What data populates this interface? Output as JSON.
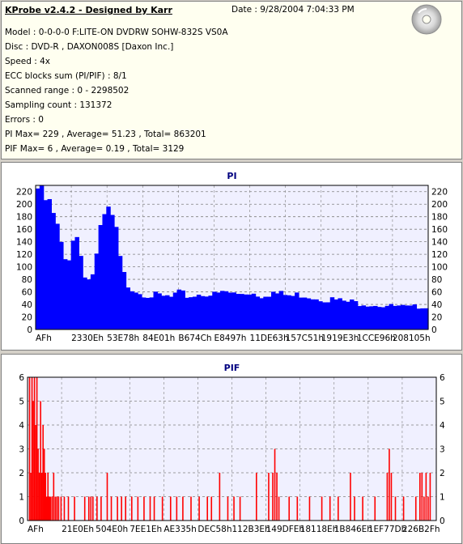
{
  "info": {
    "app_title": "KProbe v2.4.2 - Designed by Karr",
    "date": "Date : 9/28/2004 7:04:33 PM",
    "lines": [
      "Model : 0-0-0-0 F:LITE-ON DVDRW SOHW-832S  VS0A",
      "Disc : DVD-R , DAXON008S [Daxon Inc.]",
      "Speed : 4x",
      "ECC blocks sum (PI/PIF) : 8/1",
      "Scanned range : 0 - 2298502",
      "Sampling count : 131372",
      "Errors : 0",
      "PI Max= 229 , Average= 51.23 , Total= 863201",
      "PIF Max= 6 , Average= 0.19 , Total= 3129"
    ],
    "icon": "cd-disc-icon"
  },
  "colors": {
    "pi_bar": "#0000ff",
    "pif_bar": "#ff0000",
    "plot_bg": "#f0f0ff",
    "grid": "#808080",
    "title": "#000080"
  },
  "chart_data": [
    {
      "type": "area",
      "title": "PI",
      "ylim": [
        0,
        230
      ],
      "yticks": [
        0,
        20,
        40,
        60,
        80,
        100,
        120,
        140,
        160,
        180,
        200,
        220
      ],
      "xticks": [
        "AFh",
        "2330Eh",
        "53E78h",
        "84E01h",
        "B674Ch",
        "E8497h",
        "11DE63h",
        "157C51h",
        "1919E3h",
        "1CCE96h",
        "208105h"
      ],
      "x_range": [
        0,
        2298502
      ],
      "grid": true,
      "series": [
        {
          "values": [
            225,
            212,
            205,
            195,
            178,
            160,
            130,
            110,
            120,
            150,
            148,
            120,
            92,
            80,
            90,
            115,
            150,
            175,
            182,
            176,
            150,
            110,
            85,
            72,
            68,
            64,
            60,
            58,
            56,
            55,
            54,
            53,
            52,
            52,
            51,
            55,
            57,
            56,
            54,
            53,
            55,
            56,
            57,
            58,
            56,
            55,
            57,
            58,
            60,
            58,
            57,
            56,
            58,
            59,
            60,
            58,
            56,
            55,
            57,
            58,
            59,
            57,
            56,
            55,
            54,
            53,
            55,
            56,
            55,
            54,
            52,
            51,
            50,
            49,
            48,
            48,
            47,
            46,
            45,
            44,
            44,
            43,
            42,
            42,
            41,
            40,
            40,
            39,
            38,
            38,
            37,
            37,
            36,
            36,
            35,
            35,
            36,
            37,
            38,
            36
          ]
        }
      ]
    },
    {
      "type": "bar",
      "title": "PIF",
      "ylim": [
        0,
        6
      ],
      "yticks": [
        0,
        1,
        2,
        3,
        4,
        5,
        6
      ],
      "xticks": [
        "AFh",
        "21E0Eh",
        "504E0h",
        "7EE1Eh",
        "AE335h",
        "DEC58h",
        "112B3Eh",
        "149DFEh",
        "18118Eh",
        "1B846Eh",
        "1EF77Dh",
        "226B2Fh"
      ],
      "x_range": [
        0,
        2298502
      ],
      "grid": true,
      "series": [
        {
          "points": [
            [
              0.005,
              6
            ],
            [
              0.008,
              2
            ],
            [
              0.011,
              6
            ],
            [
              0.014,
              5
            ],
            [
              0.017,
              6
            ],
            [
              0.02,
              4
            ],
            [
              0.023,
              6
            ],
            [
              0.026,
              3
            ],
            [
              0.029,
              2
            ],
            [
              0.032,
              5
            ],
            [
              0.035,
              2
            ],
            [
              0.038,
              4
            ],
            [
              0.041,
              3
            ],
            [
              0.044,
              2
            ],
            [
              0.047,
              1
            ],
            [
              0.05,
              2
            ],
            [
              0.053,
              1
            ],
            [
              0.056,
              1
            ],
            [
              0.06,
              1
            ],
            [
              0.064,
              2
            ],
            [
              0.068,
              1
            ],
            [
              0.072,
              1
            ],
            [
              0.076,
              1
            ],
            [
              0.082,
              1
            ],
            [
              0.09,
              1
            ],
            [
              0.1,
              1
            ],
            [
              0.115,
              1
            ],
            [
              0.14,
              1
            ],
            [
              0.15,
              1
            ],
            [
              0.155,
              1
            ],
            [
              0.16,
              1
            ],
            [
              0.17,
              1
            ],
            [
              0.18,
              1
            ],
            [
              0.195,
              2
            ],
            [
              0.205,
              1
            ],
            [
              0.22,
              1
            ],
            [
              0.23,
              1
            ],
            [
              0.24,
              1
            ],
            [
              0.255,
              1
            ],
            [
              0.27,
              1
            ],
            [
              0.285,
              1
            ],
            [
              0.3,
              1
            ],
            [
              0.31,
              1
            ],
            [
              0.33,
              1
            ],
            [
              0.35,
              1
            ],
            [
              0.365,
              1
            ],
            [
              0.38,
              1
            ],
            [
              0.4,
              1
            ],
            [
              0.42,
              1
            ],
            [
              0.44,
              1
            ],
            [
              0.45,
              1
            ],
            [
              0.47,
              2
            ],
            [
              0.49,
              1
            ],
            [
              0.505,
              1
            ],
            [
              0.52,
              1
            ],
            [
              0.56,
              2
            ],
            [
              0.59,
              2
            ],
            [
              0.6,
              2
            ],
            [
              0.605,
              3
            ],
            [
              0.61,
              2
            ],
            [
              0.615,
              1
            ],
            [
              0.64,
              1
            ],
            [
              0.66,
              1
            ],
            [
              0.69,
              1
            ],
            [
              0.72,
              1
            ],
            [
              0.74,
              1
            ],
            [
              0.76,
              1
            ],
            [
              0.79,
              2
            ],
            [
              0.8,
              1
            ],
            [
              0.82,
              1
            ],
            [
              0.85,
              1
            ],
            [
              0.88,
              2
            ],
            [
              0.885,
              3
            ],
            [
              0.89,
              2
            ],
            [
              0.9,
              1
            ],
            [
              0.92,
              1
            ],
            [
              0.95,
              1
            ],
            [
              0.96,
              2
            ],
            [
              0.965,
              2
            ],
            [
              0.97,
              1
            ],
            [
              0.975,
              2
            ],
            [
              0.98,
              1
            ],
            [
              0.985,
              2
            ]
          ]
        }
      ]
    }
  ]
}
